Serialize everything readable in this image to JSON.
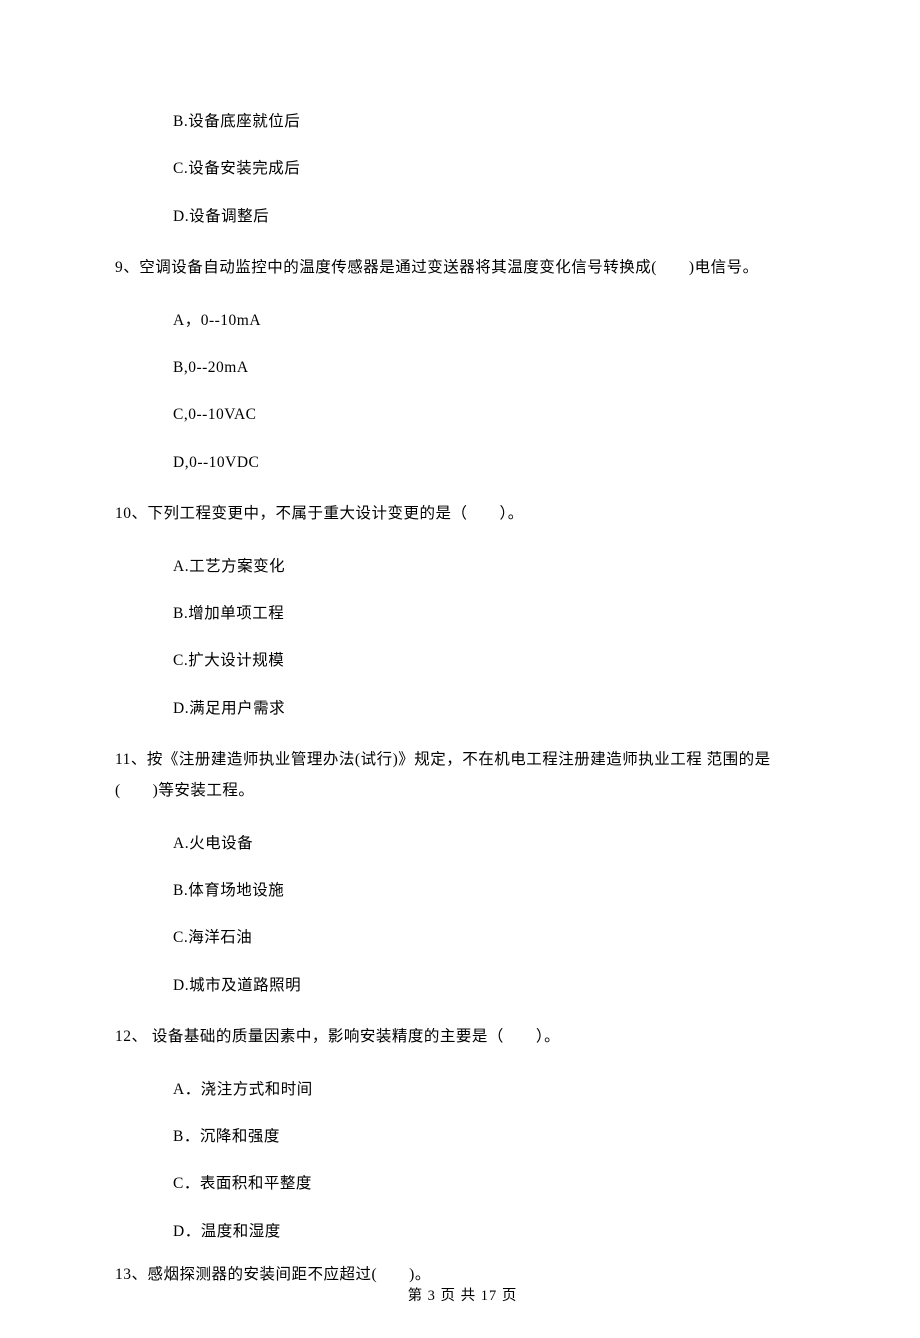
{
  "q8_options": {
    "B": "B.设备底座就位后",
    "C": "C.设备安装完成后",
    "D": "D.设备调整后"
  },
  "q9": {
    "stem": "9、空调设备自动监控中的温度传感器是通过变送器将其温度变化信号转换成(　　)电信号。",
    "A": "A，0--10mA",
    "B": "B,0--20mA",
    "C": "C,0--10VAC",
    "D": "D,0--10VDC"
  },
  "q10": {
    "stem": "10、下列工程变更中，不属于重大设计变更的是（　　）。",
    "A": "A.工艺方案变化",
    "B": "B.增加单项工程",
    "C": "C.扩大设计规模",
    "D": "D.满足用户需求"
  },
  "q11": {
    "stem": "11、按《注册建造师执业管理办法(试行)》规定，不在机电工程注册建造师执业工程 范围的是(　　)等安装工程。",
    "A": "A.火电设备",
    "B": "B.体育场地设施",
    "C": "C.海洋石油",
    "D": "D.城市及道路照明"
  },
  "q12": {
    "stem": "12、 设备基础的质量因素中，影响安装精度的主要是（　　）。",
    "A": "A．浇注方式和时间",
    "B": "B．沉降和强度",
    "C": "C．表面积和平整度",
    "D": "D．温度和湿度"
  },
  "q13": {
    "stem": "13、感烟探测器的安装间距不应超过(　　)。"
  },
  "footer": "第 3 页 共 17 页"
}
